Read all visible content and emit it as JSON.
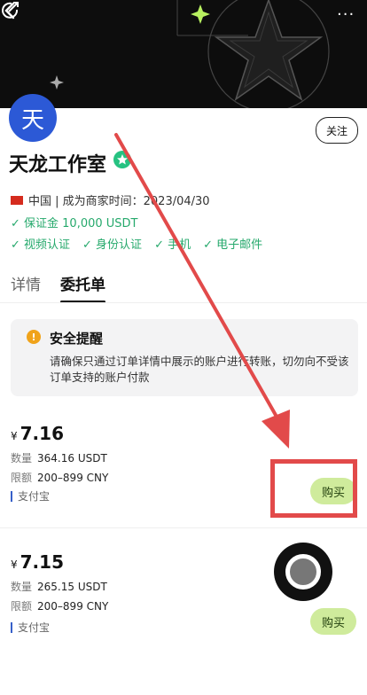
{
  "header": {
    "more_label": "···"
  },
  "merchant": {
    "avatar_char": "天",
    "name": "天龙工作室",
    "follow_label": "关注",
    "region_line": "中国 | 成为商家时间：2023/04/30",
    "deposit": "✓ 保证金 10,000 USDT",
    "verifications": [
      "✓ 视频认证",
      "✓ 身份认证",
      "✓ 手机",
      "✓ 电子邮件"
    ]
  },
  "tabs": [
    {
      "label": "详情",
      "active": false
    },
    {
      "label": "委托单",
      "active": true
    }
  ],
  "notice": {
    "title": "安全提醒",
    "body": "请确保只通过订单详情中展示的账户进行转账，切勿向不受该订单支持的账户付款"
  },
  "offers": [
    {
      "currency_symbol": "¥",
      "price": "7.16",
      "quantity_label": "数量",
      "quantity": "364.16 USDT",
      "limit_label": "限额",
      "limit": "200–899 CNY",
      "payment": "支付宝",
      "buy_label": "购买"
    },
    {
      "currency_symbol": "¥",
      "price": "7.15",
      "quantity_label": "数量",
      "quantity": "265.15 USDT",
      "limit_label": "限额",
      "limit": "200–899 CNY",
      "payment": "支付宝",
      "buy_label": "购买"
    }
  ],
  "colors": {
    "accent_green": "#26a96c",
    "buy_button": "#cfeb9c",
    "annotation_red": "#e24a4a",
    "avatar_blue": "#2c59d6"
  }
}
